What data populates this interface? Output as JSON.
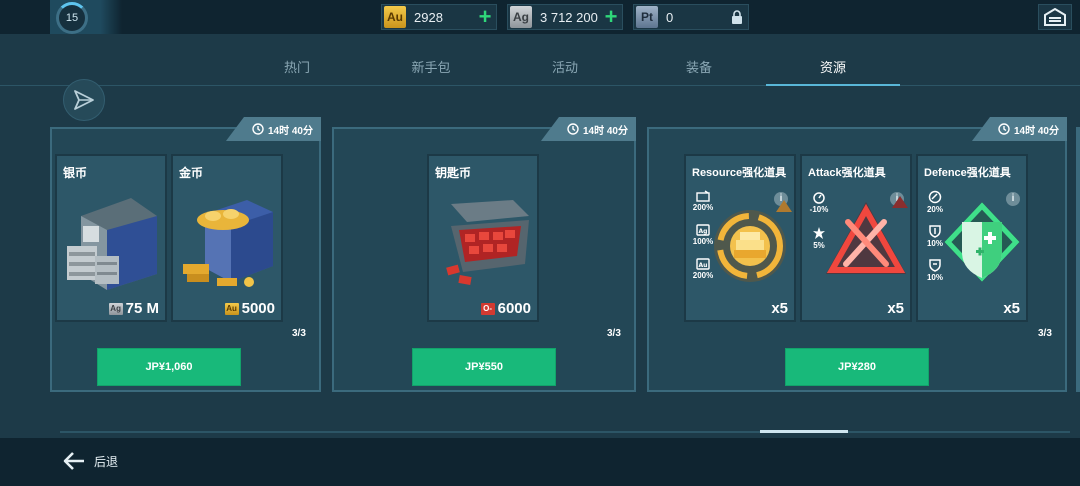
{
  "header": {
    "level": "15",
    "currencies": [
      {
        "symbol": "Au",
        "value": "2928",
        "addable": true
      },
      {
        "symbol": "Ag",
        "value": "3 712 200",
        "addable": true
      },
      {
        "symbol": "Pt",
        "value": "0",
        "locked": true
      }
    ]
  },
  "tabs": [
    {
      "label": "热门",
      "active": false
    },
    {
      "label": "新手包",
      "active": false
    },
    {
      "label": "活动",
      "active": false
    },
    {
      "label": "装备",
      "active": false
    },
    {
      "label": "资源",
      "active": true
    }
  ],
  "offers": [
    {
      "timer": "14时 40分",
      "limit": "3/3",
      "price": "JP¥1,060",
      "items": [
        {
          "title": "银币",
          "amount": "75 M",
          "amount_icon": "Ag"
        },
        {
          "title": "金币",
          "amount": "5000",
          "amount_icon": "Au"
        }
      ]
    },
    {
      "timer": "14时 40分",
      "limit": "3/3",
      "price": "JP¥550",
      "items": [
        {
          "title": "钥匙币",
          "amount": "6000",
          "amount_icon": "key-icon"
        }
      ]
    },
    {
      "timer": "14时 40分",
      "limit": "3/3",
      "price": "JP¥280",
      "items": [
        {
          "title": "Resource强化道具",
          "qty": "x5",
          "stats": [
            "200%",
            "100%",
            "200%"
          ],
          "info": "i"
        },
        {
          "title": "Attack强化道具",
          "qty": "x5",
          "stats": [
            "-10%",
            "5%"
          ],
          "info": "i"
        },
        {
          "title": "Defence强化道具",
          "qty": "x5",
          "stats": [
            "20%",
            "10%",
            "10%"
          ],
          "info": "i"
        }
      ]
    }
  ],
  "footer": {
    "back_label": "后退"
  },
  "colors": {
    "buy_button": "#18b97a",
    "panel": "#234756",
    "accent": "#59b7d8"
  }
}
